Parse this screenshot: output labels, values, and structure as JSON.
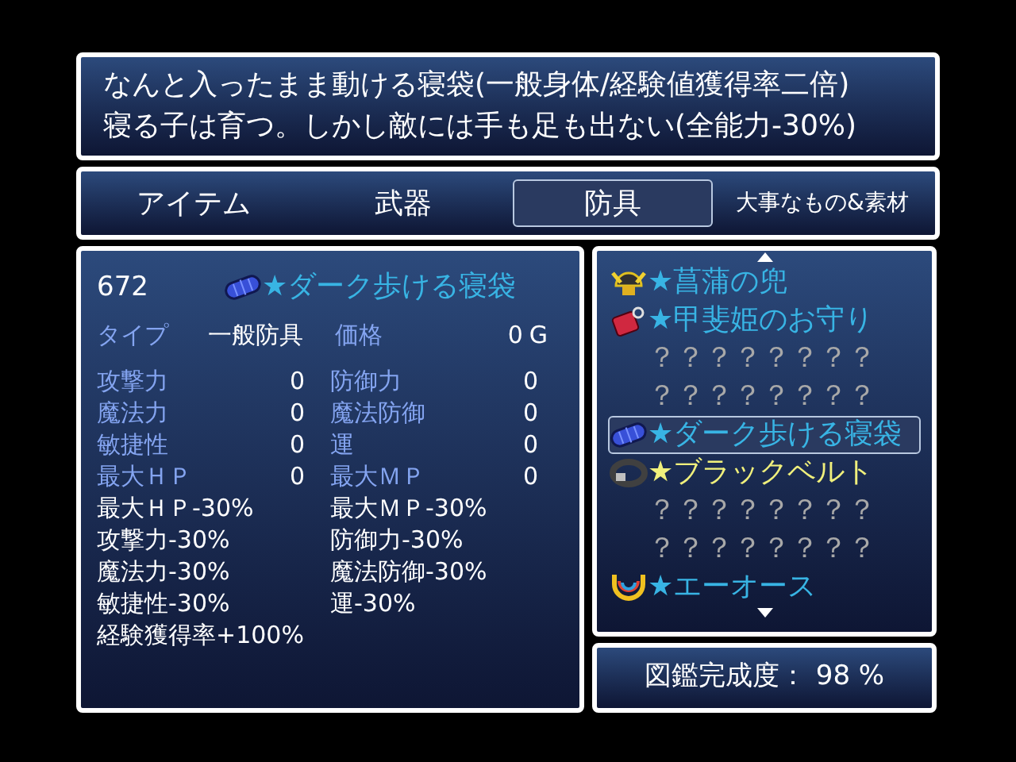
{
  "help": {
    "lines": [
      "なんと入ったまま動ける寝袋(一般身体/経験値獲得率二倍)",
      "寝る子は育つ。しかし敵には手も足も出ない(全能力-30%)"
    ]
  },
  "tabs": [
    {
      "label": "アイテム",
      "selected": false
    },
    {
      "label": "武器",
      "selected": false
    },
    {
      "label": "防具",
      "selected": true
    },
    {
      "label": "大事なもの&素材",
      "selected": false
    }
  ],
  "detail": {
    "number": "672",
    "item": {
      "name": "★ダーク歩ける寝袋",
      "kind": "bag",
      "color": "#38b4e4"
    },
    "type_label": "タイプ",
    "type_value": "一般防具",
    "price_label": "価格",
    "price_value": "0",
    "currency": "G",
    "stats": [
      [
        {
          "label": "攻撃力",
          "value": "0"
        },
        {
          "label": "防御力",
          "value": "0"
        }
      ],
      [
        {
          "label": "魔法力",
          "value": "0"
        },
        {
          "label": "魔法防御",
          "value": "0"
        }
      ],
      [
        {
          "label": "敏捷性",
          "value": "0"
        },
        {
          "label": "運",
          "value": "0"
        }
      ],
      [
        {
          "label": "最大ＨＰ",
          "value": "0"
        },
        {
          "label": "最大ＭＰ",
          "value": "0"
        }
      ]
    ],
    "effects": [
      [
        "最大ＨＰ-30%",
        "最大ＭＰ-30%"
      ],
      [
        "攻撃力-30%",
        "防御力-30%"
      ],
      [
        "魔法力-30%",
        "魔法防御-30%"
      ],
      [
        "敏捷性-30%",
        "運-30%"
      ],
      [
        "経験獲得率+100%"
      ]
    ]
  },
  "list": [
    {
      "name": "★菖蒲の兜",
      "kind": "helmet",
      "color": "#38b4e4",
      "selected": false
    },
    {
      "name": "★甲斐姫のお守り",
      "kind": "charm",
      "color": "#38b4e4",
      "selected": false
    },
    {
      "name": "？？？？？？？？",
      "kind": "unknown",
      "color": "#a8a8a8",
      "selected": false
    },
    {
      "name": "？？？？？？？？",
      "kind": "unknown",
      "color": "#a8a8a8",
      "selected": false
    },
    {
      "name": "★ダーク歩ける寝袋",
      "kind": "bag",
      "color": "#38b4e4",
      "selected": true
    },
    {
      "name": "★ブラックベルト",
      "kind": "belt",
      "color": "#f0f07c",
      "selected": false
    },
    {
      "name": "？？？？？？？？",
      "kind": "unknown",
      "color": "#a8a8a8",
      "selected": false
    },
    {
      "name": "？？？？？？？？",
      "kind": "unknown",
      "color": "#a8a8a8",
      "selected": false
    },
    {
      "name": "★エーオース",
      "kind": "necklace",
      "color": "#38b4e4",
      "selected": false
    }
  ],
  "completion": {
    "label": "図鑑完成度：",
    "value": "98 %"
  }
}
